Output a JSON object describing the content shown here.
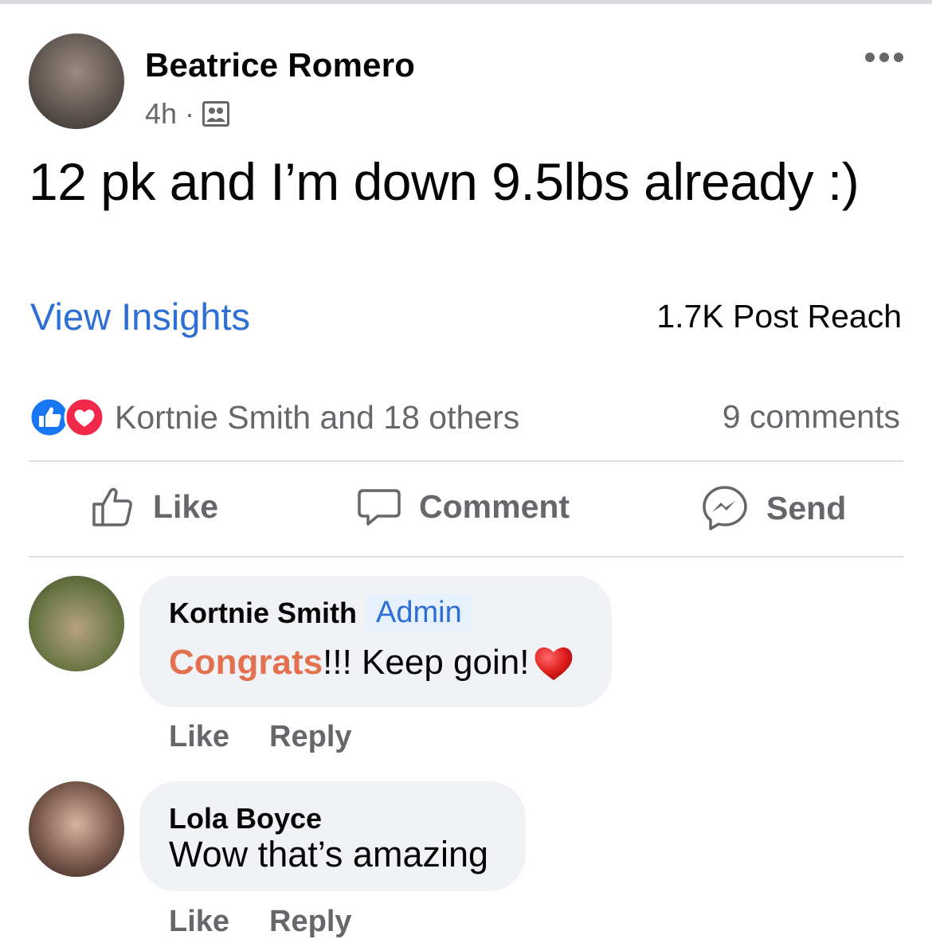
{
  "post": {
    "author": "Beatrice Romero",
    "time": "4h",
    "separator": "·",
    "text": "12 pk and I’m down 9.5lbs already :)"
  },
  "insights": {
    "link_label": "View Insights",
    "reach": "1.7K Post Reach"
  },
  "reactions": {
    "summary": "Kortnie Smith and 18 others",
    "comments_count": "9 comments"
  },
  "actions": {
    "like": "Like",
    "comment": "Comment",
    "send": "Send"
  },
  "comments": [
    {
      "name": "Kortnie Smith",
      "badge": "Admin",
      "highlight": "Congrats",
      "text": "!!! Keep goin!",
      "like": "Like",
      "reply": "Reply"
    },
    {
      "name": "Lola Boyce",
      "text": "Wow that’s amazing",
      "like": "Like",
      "reply": "Reply"
    }
  ],
  "icons": [
    "more-options-icon",
    "group-audience-icon",
    "like-reaction-icon",
    "love-reaction-icon",
    "thumbs-up-icon",
    "comment-icon",
    "messenger-icon",
    "red-heart-emoji"
  ],
  "colors": {
    "link_blue": "#2e6fd6",
    "secondary_text": "#65676b",
    "bubble_bg": "#f0f2f5",
    "like_blue": "#1877f2",
    "love_red": "#f0284a",
    "congrats_orange": "#e3704f"
  }
}
